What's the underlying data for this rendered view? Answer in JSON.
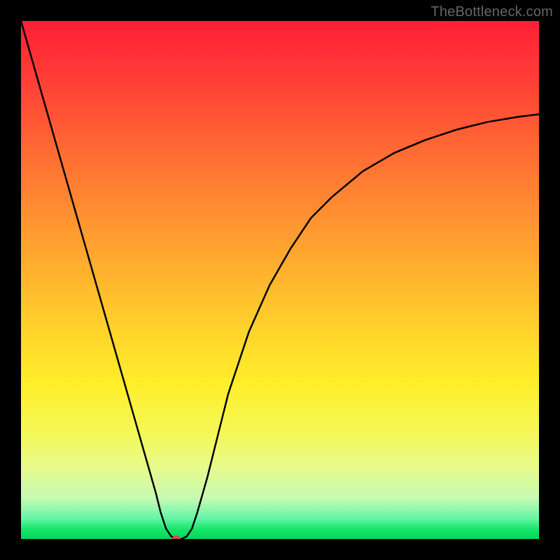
{
  "watermark": "TheBottleneck.com",
  "chart_data": {
    "type": "line",
    "title": "",
    "xlabel": "",
    "ylabel": "",
    "xlim": [
      0,
      100
    ],
    "ylim": [
      0,
      100
    ],
    "grid": false,
    "legend": false,
    "background_gradient": {
      "top": "#ff1f36",
      "middle": "#ffd42c",
      "bottom": "#00d85a"
    },
    "series": [
      {
        "name": "curve",
        "color": "#000000",
        "x": [
          0,
          2,
          4,
          6,
          8,
          10,
          12,
          14,
          16,
          18,
          20,
          22,
          24,
          26,
          27,
          28,
          29,
          30,
          31,
          32,
          33,
          34,
          36,
          38,
          40,
          44,
          48,
          52,
          56,
          60,
          66,
          72,
          78,
          84,
          90,
          96,
          100
        ],
        "y": [
          100,
          93,
          86,
          79,
          72,
          65,
          58,
          51,
          44,
          37,
          30,
          23,
          16,
          9,
          5,
          2,
          0.5,
          0,
          0,
          0.5,
          2,
          5,
          12,
          20,
          28,
          40,
          49,
          56,
          62,
          66,
          71,
          74.5,
          77,
          79,
          80.5,
          81.5,
          82
        ]
      }
    ],
    "marker": {
      "x": 30,
      "y": 0,
      "color": "#d04a4a",
      "rx": 6,
      "ry": 5
    }
  }
}
